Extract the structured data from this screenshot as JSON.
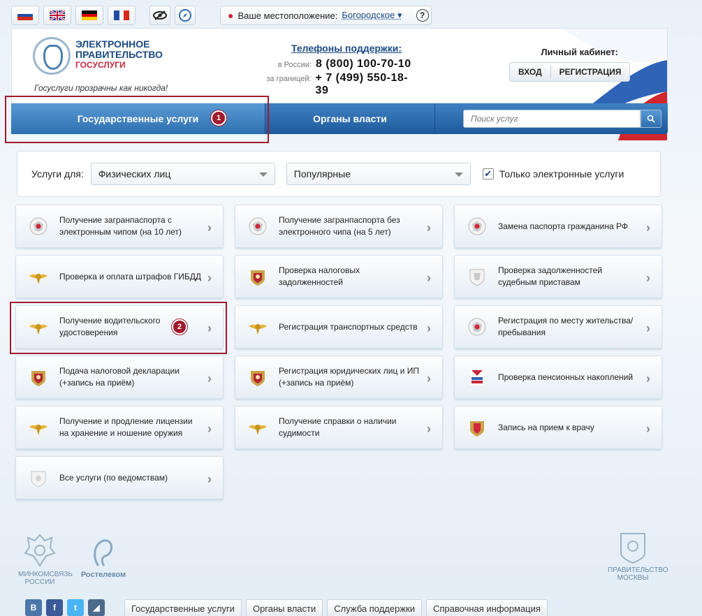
{
  "langs": [
    {
      "name": "ru-flag-icon"
    },
    {
      "name": "en-flag-icon"
    },
    {
      "name": "de-flag-icon"
    },
    {
      "name": "fr-flag-icon"
    }
  ],
  "location": {
    "label": "Ваше местоположение:",
    "value": "Богородское"
  },
  "header": {
    "logo_line1": "ЭЛЕКТРОННОЕ",
    "logo_line2": "ПРАВИТЕЛЬСТВО",
    "logo_line3": "ГОСУСЛУГИ",
    "slogan": "Госуслуги прозрачны как никогда!",
    "support_title": "Телефоны поддержки",
    "russia_label": "в России:",
    "russia_phone": "8 (800) 100-70-10",
    "abroad_label": "за границей:",
    "abroad_phone": "+ 7 (499) 550-18-39",
    "cabinet_title": "Личный кабинет:",
    "login": "ВХОД",
    "register": "РЕГИСТРАЦИЯ"
  },
  "nav": {
    "tab_services": "Государственные услуги",
    "tab_authorities": "Органы власти",
    "search_placeholder": "Поиск услуг"
  },
  "annotations": {
    "badge1": "1",
    "badge2": "2"
  },
  "filters": {
    "services_for_label": "Услуги для:",
    "audience": "Физических лиц",
    "sort": "Популярные",
    "electronic_only": "Только электронные услуги"
  },
  "services": [
    {
      "label": "Получение загранпаспорта с электронным чипом (на 10 лет)",
      "icon": "fms-emblem-icon"
    },
    {
      "label": "Получение загранпаспорта без электронного чипа (на 5 лет)",
      "icon": "fms-emblem-icon"
    },
    {
      "label": "Замена паспорта гражданина РФ",
      "icon": "fms-emblem-icon"
    },
    {
      "label": "Проверка и оплата штрафов ГИБДД",
      "icon": "mvd-eagle-icon"
    },
    {
      "label": "Проверка налоговых задолженностей",
      "icon": "fns-emblem-icon"
    },
    {
      "label": "Проверка задолженностей судебным приставам",
      "icon": "fssp-emblem-icon"
    },
    {
      "label": "Получение водительского удостоверения",
      "icon": "mvd-eagle-icon"
    },
    {
      "label": "Регистрация транспортных средств",
      "icon": "mvd-eagle-icon"
    },
    {
      "label": "Регистрация по месту жительства/пребывания",
      "icon": "fms-emblem-icon"
    },
    {
      "label": "Подача налоговой декларации (+запись на приём)",
      "icon": "fns-emblem-icon"
    },
    {
      "label": "Регистрация юридических лиц и ИП (+запись на приём)",
      "icon": "fns-emblem-icon"
    },
    {
      "label": "Проверка пенсионных накоплений",
      "icon": "pfr-logo-icon"
    },
    {
      "label": "Получение и продление лицензии на хранение и ношение оружия",
      "icon": "mvd-eagle-icon"
    },
    {
      "label": "Получение справки о наличии судимости",
      "icon": "mvd-eagle-icon"
    },
    {
      "label": "Запись на прием к врачу",
      "icon": "health-emblem-icon"
    },
    {
      "label": "Все услуги (по ведомствам)",
      "icon": "gov-emblem-icon"
    }
  ],
  "footer": {
    "minsvyaz_line1": "МИНКОМСВЯЗЬ",
    "minsvyaz_line2": "РОССИИ",
    "rostelecom": "Ростелеком",
    "moscow_line1": "ПРАВИТЕЛЬСТВО",
    "moscow_line2": "МОСКВЫ",
    "links": [
      "Государственные услуги",
      "Органы власти",
      "Служба поддержки",
      "Справочная информация"
    ]
  },
  "colors": {
    "accent": "#1d5a9c",
    "annotation": "#a11a2c"
  }
}
